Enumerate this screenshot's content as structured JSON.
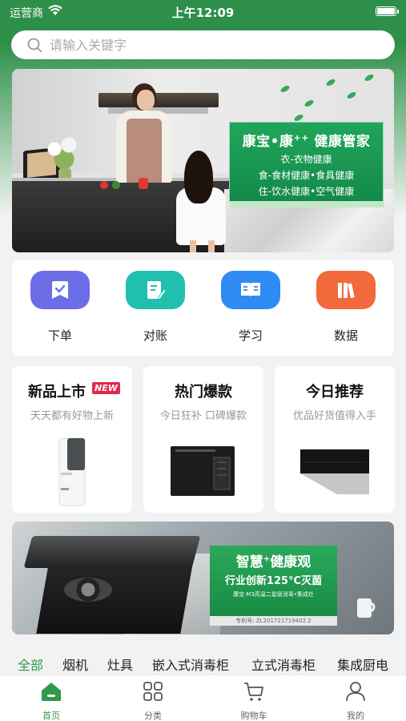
{
  "status_bar": {
    "carrier": "运营商",
    "time": "上午12:09"
  },
  "search": {
    "placeholder": "请输入关键字"
  },
  "banner": {
    "headline": "康宝•康",
    "headline_sup": "++",
    "headline_tail": " 健康管家",
    "lines": [
      "衣-衣物健康",
      "食-食材健康•食具健康",
      "住-饮水健康•空气健康"
    ]
  },
  "quick_actions": [
    {
      "label": "下单",
      "icon": "order-icon",
      "color": "#6b6ee6"
    },
    {
      "label": "对账",
      "icon": "reconcile-icon",
      "color": "#21bfae"
    },
    {
      "label": "学习",
      "icon": "book-icon",
      "color": "#2f8cf5"
    },
    {
      "label": "数据",
      "icon": "data-icon",
      "color": "#f2693c"
    }
  ],
  "cards": [
    {
      "title": "新品上市",
      "badge": "NEW",
      "subtitle": "天天都有好物上新"
    },
    {
      "title": "热门爆款",
      "subtitle": "今日狂补 口碑爆款"
    },
    {
      "title": "今日推荐",
      "subtitle": "优品好货值得入手"
    }
  ],
  "banner2": {
    "title": "智慧",
    "title_sup": "+",
    "title_tail": "健康观",
    "subtitle": "行业创新125°C灭菌",
    "small": "康宝·M3高温二星级消毒•集成灶",
    "patent": "专利号: ZL201721719402.2"
  },
  "category_tabs": [
    "全部",
    "烟机",
    "灶具",
    "嵌入式消毒柜",
    "立式消毒柜",
    "集成厨电"
  ],
  "bottom_nav": [
    {
      "label": "首页",
      "icon": "home-icon"
    },
    {
      "label": "分类",
      "icon": "category-icon"
    },
    {
      "label": "购物车",
      "icon": "cart-icon"
    },
    {
      "label": "我的",
      "icon": "profile-icon"
    }
  ],
  "colors": {
    "brand_green": "#2e9a4c",
    "header_green": "#2e8f4a",
    "new_badge": "#e0284a"
  }
}
